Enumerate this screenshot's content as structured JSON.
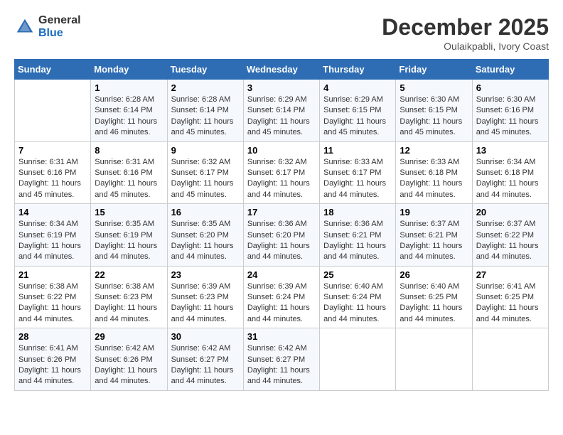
{
  "header": {
    "logo_general": "General",
    "logo_blue": "Blue",
    "month_title": "December 2025",
    "location": "Oulaikpabli, Ivory Coast"
  },
  "days_of_week": [
    "Sunday",
    "Monday",
    "Tuesday",
    "Wednesday",
    "Thursday",
    "Friday",
    "Saturday"
  ],
  "weeks": [
    [
      {
        "day": "",
        "sunrise": "",
        "sunset": "",
        "daylight": ""
      },
      {
        "day": "1",
        "sunrise": "Sunrise: 6:28 AM",
        "sunset": "Sunset: 6:14 PM",
        "daylight": "Daylight: 11 hours and 46 minutes."
      },
      {
        "day": "2",
        "sunrise": "Sunrise: 6:28 AM",
        "sunset": "Sunset: 6:14 PM",
        "daylight": "Daylight: 11 hours and 45 minutes."
      },
      {
        "day": "3",
        "sunrise": "Sunrise: 6:29 AM",
        "sunset": "Sunset: 6:14 PM",
        "daylight": "Daylight: 11 hours and 45 minutes."
      },
      {
        "day": "4",
        "sunrise": "Sunrise: 6:29 AM",
        "sunset": "Sunset: 6:15 PM",
        "daylight": "Daylight: 11 hours and 45 minutes."
      },
      {
        "day": "5",
        "sunrise": "Sunrise: 6:30 AM",
        "sunset": "Sunset: 6:15 PM",
        "daylight": "Daylight: 11 hours and 45 minutes."
      },
      {
        "day": "6",
        "sunrise": "Sunrise: 6:30 AM",
        "sunset": "Sunset: 6:16 PM",
        "daylight": "Daylight: 11 hours and 45 minutes."
      }
    ],
    [
      {
        "day": "7",
        "sunrise": "Sunrise: 6:31 AM",
        "sunset": "Sunset: 6:16 PM",
        "daylight": "Daylight: 11 hours and 45 minutes."
      },
      {
        "day": "8",
        "sunrise": "Sunrise: 6:31 AM",
        "sunset": "Sunset: 6:16 PM",
        "daylight": "Daylight: 11 hours and 45 minutes."
      },
      {
        "day": "9",
        "sunrise": "Sunrise: 6:32 AM",
        "sunset": "Sunset: 6:17 PM",
        "daylight": "Daylight: 11 hours and 45 minutes."
      },
      {
        "day": "10",
        "sunrise": "Sunrise: 6:32 AM",
        "sunset": "Sunset: 6:17 PM",
        "daylight": "Daylight: 11 hours and 44 minutes."
      },
      {
        "day": "11",
        "sunrise": "Sunrise: 6:33 AM",
        "sunset": "Sunset: 6:17 PM",
        "daylight": "Daylight: 11 hours and 44 minutes."
      },
      {
        "day": "12",
        "sunrise": "Sunrise: 6:33 AM",
        "sunset": "Sunset: 6:18 PM",
        "daylight": "Daylight: 11 hours and 44 minutes."
      },
      {
        "day": "13",
        "sunrise": "Sunrise: 6:34 AM",
        "sunset": "Sunset: 6:18 PM",
        "daylight": "Daylight: 11 hours and 44 minutes."
      }
    ],
    [
      {
        "day": "14",
        "sunrise": "Sunrise: 6:34 AM",
        "sunset": "Sunset: 6:19 PM",
        "daylight": "Daylight: 11 hours and 44 minutes."
      },
      {
        "day": "15",
        "sunrise": "Sunrise: 6:35 AM",
        "sunset": "Sunset: 6:19 PM",
        "daylight": "Daylight: 11 hours and 44 minutes."
      },
      {
        "day": "16",
        "sunrise": "Sunrise: 6:35 AM",
        "sunset": "Sunset: 6:20 PM",
        "daylight": "Daylight: 11 hours and 44 minutes."
      },
      {
        "day": "17",
        "sunrise": "Sunrise: 6:36 AM",
        "sunset": "Sunset: 6:20 PM",
        "daylight": "Daylight: 11 hours and 44 minutes."
      },
      {
        "day": "18",
        "sunrise": "Sunrise: 6:36 AM",
        "sunset": "Sunset: 6:21 PM",
        "daylight": "Daylight: 11 hours and 44 minutes."
      },
      {
        "day": "19",
        "sunrise": "Sunrise: 6:37 AM",
        "sunset": "Sunset: 6:21 PM",
        "daylight": "Daylight: 11 hours and 44 minutes."
      },
      {
        "day": "20",
        "sunrise": "Sunrise: 6:37 AM",
        "sunset": "Sunset: 6:22 PM",
        "daylight": "Daylight: 11 hours and 44 minutes."
      }
    ],
    [
      {
        "day": "21",
        "sunrise": "Sunrise: 6:38 AM",
        "sunset": "Sunset: 6:22 PM",
        "daylight": "Daylight: 11 hours and 44 minutes."
      },
      {
        "day": "22",
        "sunrise": "Sunrise: 6:38 AM",
        "sunset": "Sunset: 6:23 PM",
        "daylight": "Daylight: 11 hours and 44 minutes."
      },
      {
        "day": "23",
        "sunrise": "Sunrise: 6:39 AM",
        "sunset": "Sunset: 6:23 PM",
        "daylight": "Daylight: 11 hours and 44 minutes."
      },
      {
        "day": "24",
        "sunrise": "Sunrise: 6:39 AM",
        "sunset": "Sunset: 6:24 PM",
        "daylight": "Daylight: 11 hours and 44 minutes."
      },
      {
        "day": "25",
        "sunrise": "Sunrise: 6:40 AM",
        "sunset": "Sunset: 6:24 PM",
        "daylight": "Daylight: 11 hours and 44 minutes."
      },
      {
        "day": "26",
        "sunrise": "Sunrise: 6:40 AM",
        "sunset": "Sunset: 6:25 PM",
        "daylight": "Daylight: 11 hours and 44 minutes."
      },
      {
        "day": "27",
        "sunrise": "Sunrise: 6:41 AM",
        "sunset": "Sunset: 6:25 PM",
        "daylight": "Daylight: 11 hours and 44 minutes."
      }
    ],
    [
      {
        "day": "28",
        "sunrise": "Sunrise: 6:41 AM",
        "sunset": "Sunset: 6:26 PM",
        "daylight": "Daylight: 11 hours and 44 minutes."
      },
      {
        "day": "29",
        "sunrise": "Sunrise: 6:42 AM",
        "sunset": "Sunset: 6:26 PM",
        "daylight": "Daylight: 11 hours and 44 minutes."
      },
      {
        "day": "30",
        "sunrise": "Sunrise: 6:42 AM",
        "sunset": "Sunset: 6:27 PM",
        "daylight": "Daylight: 11 hours and 44 minutes."
      },
      {
        "day": "31",
        "sunrise": "Sunrise: 6:42 AM",
        "sunset": "Sunset: 6:27 PM",
        "daylight": "Daylight: 11 hours and 44 minutes."
      },
      {
        "day": "",
        "sunrise": "",
        "sunset": "",
        "daylight": ""
      },
      {
        "day": "",
        "sunrise": "",
        "sunset": "",
        "daylight": ""
      },
      {
        "day": "",
        "sunrise": "",
        "sunset": "",
        "daylight": ""
      }
    ]
  ]
}
